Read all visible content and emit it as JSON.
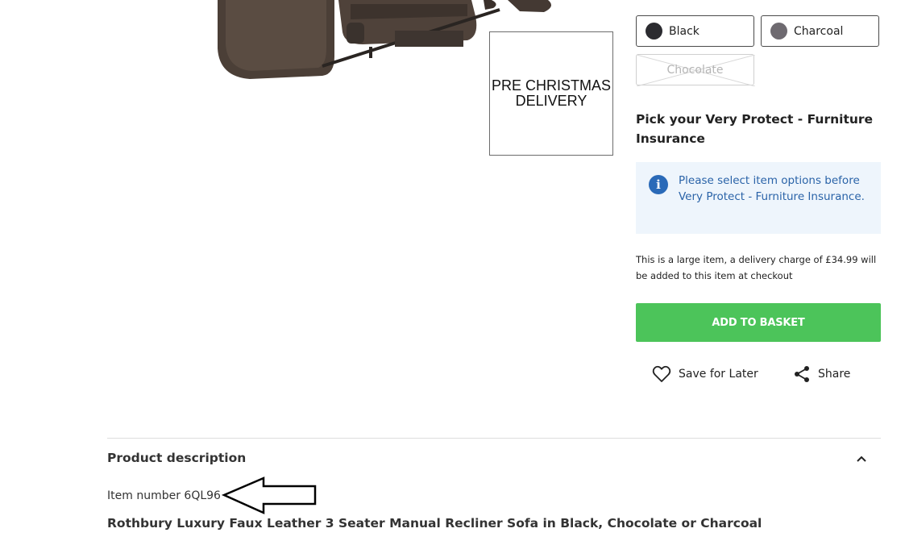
{
  "promo": {
    "text": "PRE CHRISTMAS\nDELIVERY"
  },
  "colour_options": [
    {
      "label": "Black",
      "color": "#2b2b30",
      "available": true
    },
    {
      "label": "Charcoal",
      "color": "#6e6a70",
      "available": true
    },
    {
      "label": "Chocolate",
      "color": "",
      "available": false
    }
  ],
  "insurance": {
    "title": "Pick your Very Protect - Furniture Insurance",
    "info_icon": "info-icon",
    "info_text": "Please select item options before Very Protect - Furniture Insurance."
  },
  "delivery_note": "This is a large item, a delivery charge of £34.99 will be added to this item at checkout",
  "actions": {
    "add_to_basket": "ADD TO BASKET",
    "save_for_later": "Save for Later",
    "save_icon": "heart-icon",
    "share": "Share",
    "share_icon": "share-icon"
  },
  "product_description": {
    "heading": "Product description",
    "toggle_icon": "chevron-up-icon",
    "item_number": "Item number 6QL96",
    "title": "Rothbury Luxury Faux Leather 3 Seater Manual Recliner Sofa in Black, Chocolate or Charcoal"
  },
  "colors": {
    "accent_green": "#4cc45a",
    "info_blue": "#2a6ab8",
    "info_bg": "#eef5fc"
  }
}
